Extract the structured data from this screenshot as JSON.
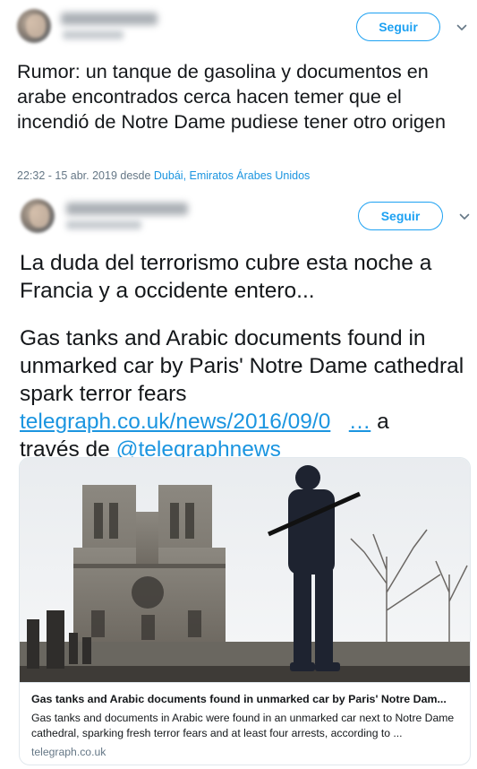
{
  "tweet1": {
    "follow_label": "Seguir",
    "text": "Rumor: un tanque de gasolina y documentos en arabe encontrados cerca hacen  temer que el incendió de Notre Dame pudiese tener otro origen",
    "timestamp": "22:32 - 15 abr. 2019 desde ",
    "location": "Dubái, Emiratos Árabes Unidos"
  },
  "tweet2": {
    "follow_label": "Seguir",
    "text_spanish": "La duda del terrorismo cubre esta noche a Francia y a occidente entero...",
    "text_english": "Gas tanks and Arabic documents found in unmarked car by Paris' Notre Dame cathedral spark terror fears",
    "link_text": "telegraph.co.uk/news/2016/09/0",
    "ellipsis": "…",
    "via_a": " a",
    "via_prefix": "través de ",
    "mention": "@telegraphnews"
  },
  "card": {
    "title": "Gas tanks and Arabic documents found in unmarked car by Paris' Notre Dam...",
    "description": "Gas tanks and documents in Arabic were found in an unmarked car next to Notre Dame cathedral, sparking fresh terror fears and at least four arrests, according to ...",
    "domain": "telegraph.co.uk"
  },
  "icons": {
    "menu_chevron": "chevron-down-icon"
  },
  "colors": {
    "accent": "#1da1f2",
    "link": "#1b95e0",
    "muted": "#657786",
    "text": "#14171a"
  }
}
